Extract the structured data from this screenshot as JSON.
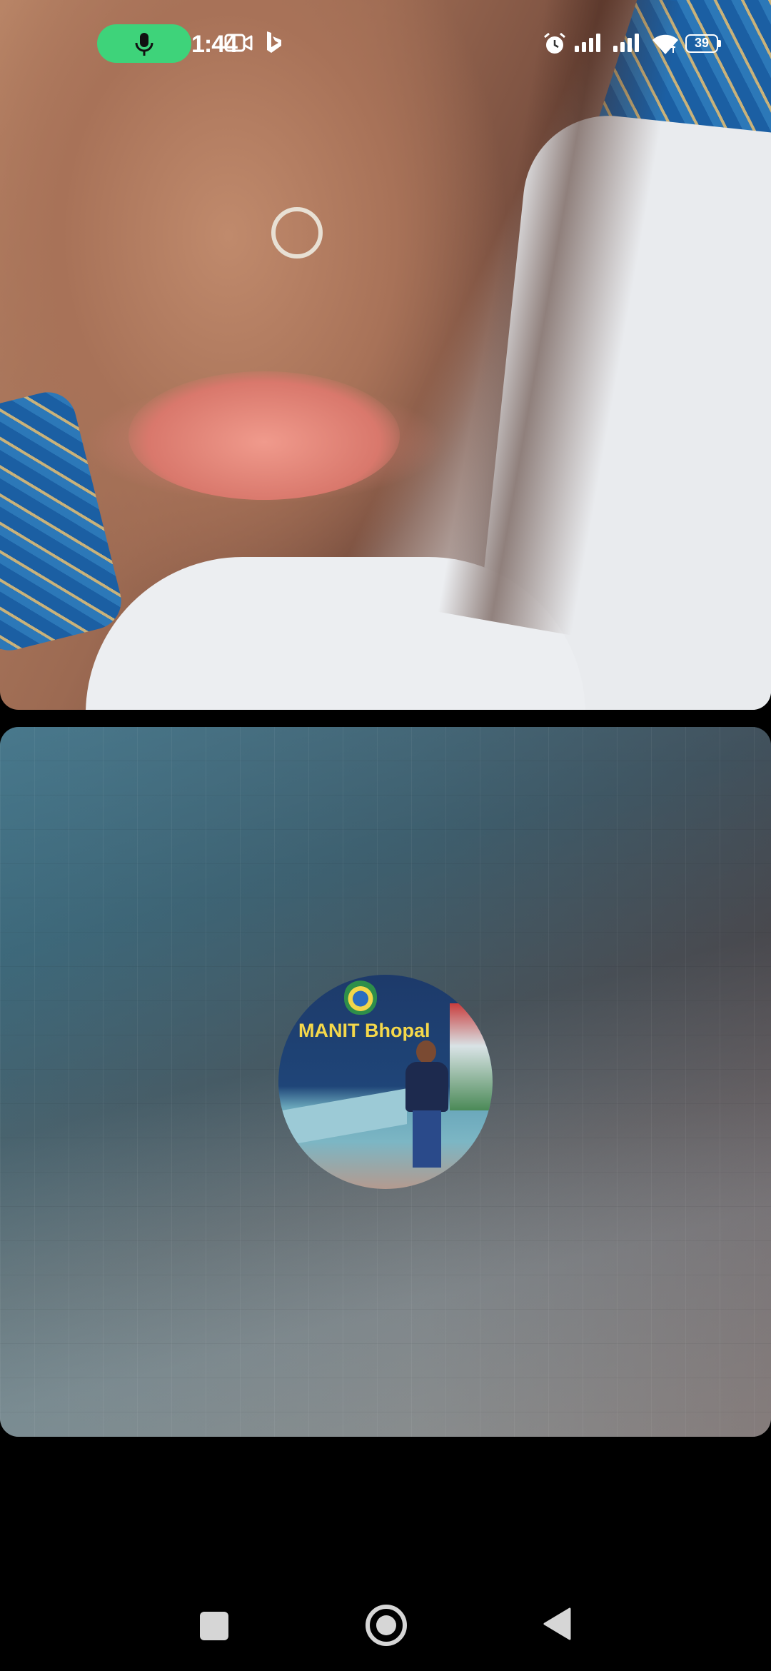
{
  "status_bar": {
    "time": "1:44",
    "battery_level": "39",
    "icons": [
      "microphone-icon",
      "video-camera-icon",
      "bing-icon",
      "alarm-icon",
      "signal-icon",
      "signal-icon",
      "wifi-icon",
      "battery-icon"
    ]
  },
  "call": {
    "remote_video": "remote participant video feed",
    "local_avatar_sign": "MANIT Bhopal"
  },
  "navigation_bar": {
    "buttons": [
      "recents-button",
      "home-button",
      "back-button"
    ]
  },
  "colors": {
    "mic_indicator": "#3ed37a",
    "background": "#000000",
    "nav_icons": "#d6d6d6"
  }
}
